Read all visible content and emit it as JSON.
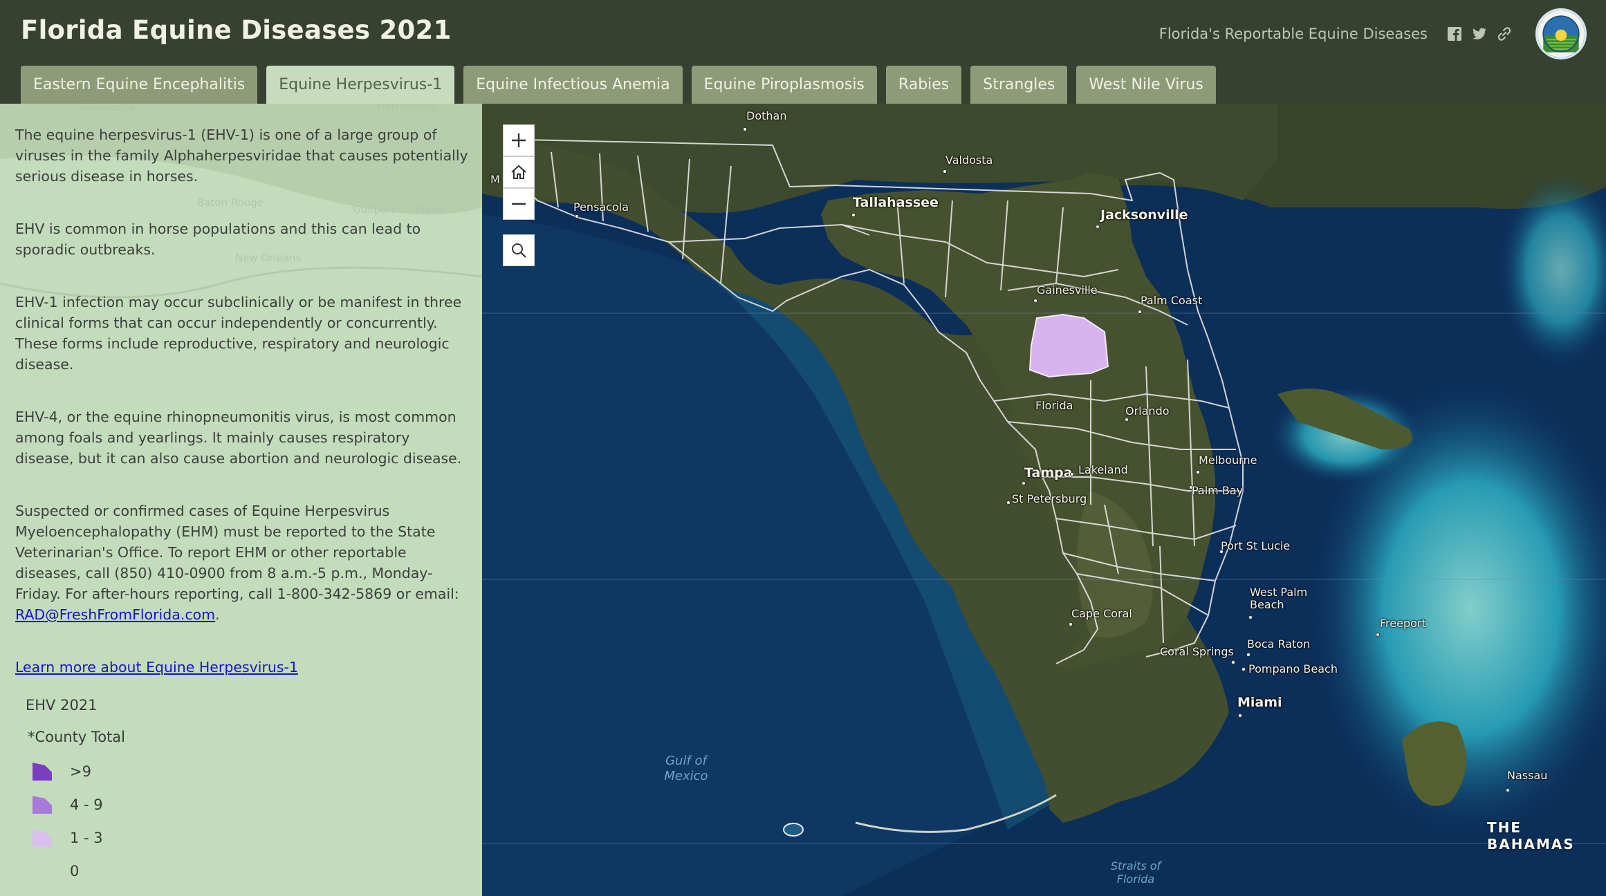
{
  "header": {
    "title": "Florida Equine Diseases 2021",
    "subtitle_link": "Florida's Reportable Equine Diseases",
    "social_icons": [
      "facebook-icon",
      "twitter-icon",
      "link-icon"
    ]
  },
  "tabs": [
    {
      "label": "Eastern Equine Encephalitis",
      "active": false
    },
    {
      "label": "Equine Herpesvirus-1",
      "active": true
    },
    {
      "label": "Equine Infectious Anemia",
      "active": false
    },
    {
      "label": "Equine Piroplasmosis",
      "active": false
    },
    {
      "label": "Rabies",
      "active": false
    },
    {
      "label": "Strangles",
      "active": false
    },
    {
      "label": "West Nile Virus",
      "active": false
    }
  ],
  "sidebar": {
    "paragraphs": [
      "The equine herpesvirus-1 (EHV-1) is one of a large group of viruses in the family Alphaherpesviridae that causes potentially serious disease in horses.",
      "EHV is common in horse populations and this can lead to sporadic outbreaks.",
      "EHV-1 infection may occur subclinically or be manifest in three clinical forms that can occur independently or concurrently. These forms include reproductive, respiratory and neurologic disease.",
      "EHV-4, or the equine rhinopneumonitis virus, is most common among foals and yearlings. It mainly causes respiratory disease, but it can also cause abortion and neurologic disease."
    ],
    "report_text": "Suspected or confirmed cases of Equine Herpesvirus Myeloencephalopathy (EHM) must be reported to the State Veterinarian's Office. To report EHM or other reportable diseases, call (850) 410-0900 from 8 a.m.-5 p.m., Monday-Friday. For after-hours reporting, call 1-800-342-5869 or email:",
    "email_link": "RAD@FreshFromFlorida.com",
    "email_suffix": ".",
    "learn_more_link": "Learn more about Equine Herpesvirus-1",
    "ghost_labels": [
      "Alexandria",
      "Hattiesburg",
      "Baton Rouge",
      "Biloxi",
      "Gulfport",
      "New Orleans"
    ]
  },
  "legend": {
    "title": "EHV 2021",
    "subtitle": "*County Total",
    "items": [
      {
        "label": ">9",
        "color": "#7a3fc0"
      },
      {
        "label": "4 - 9",
        "color": "#a77ad9"
      },
      {
        "label": "1 - 3",
        "color": "#d8bfee"
      },
      {
        "label": "0",
        "color": ""
      }
    ]
  },
  "map": {
    "controls": [
      "zoom-in-icon",
      "home-icon",
      "zoom-out-icon",
      "search-icon"
    ],
    "cities": {
      "dothan": "Dothan",
      "valdosta": "Valdosta",
      "pensacola": "Pensacola",
      "tallahassee": "Tallahassee",
      "jacksonville": "Jacksonville",
      "gainesville": "Gainesville",
      "palm_coast": "Palm Coast",
      "florida": "Florida",
      "orlando": "Orlando",
      "melbourne": "Melbourne",
      "tampa": "Tampa",
      "lakeland": "Lakeland",
      "palm_bay": "Palm Bay",
      "st_petersburg": "St Petersburg",
      "port_st_lucie": "Port St Lucie",
      "west_palm_beach": "West Palm Beach",
      "freeport": "Freeport",
      "cape_coral": "Cape Coral",
      "boca_raton": "Boca Raton",
      "coral_springs": "Coral Springs",
      "pompano_beach": "Pompano Beach",
      "miami": "Miami",
      "nassau": "Nassau",
      "m_partial": "M"
    },
    "water_labels": {
      "gulf": "Gulf of Mexico",
      "straits": "Straits of Florida"
    },
    "country_label": "THE BAHAMAS",
    "highlighted_county": {
      "name": "Marion County",
      "category": "1 - 3",
      "color": "#d8b4ef"
    },
    "colors": {
      "ocean_deep": "#0c2f5a",
      "land": "#3f4a2c",
      "shelf": "#175c7e",
      "shallows": "#39b6c6"
    }
  }
}
